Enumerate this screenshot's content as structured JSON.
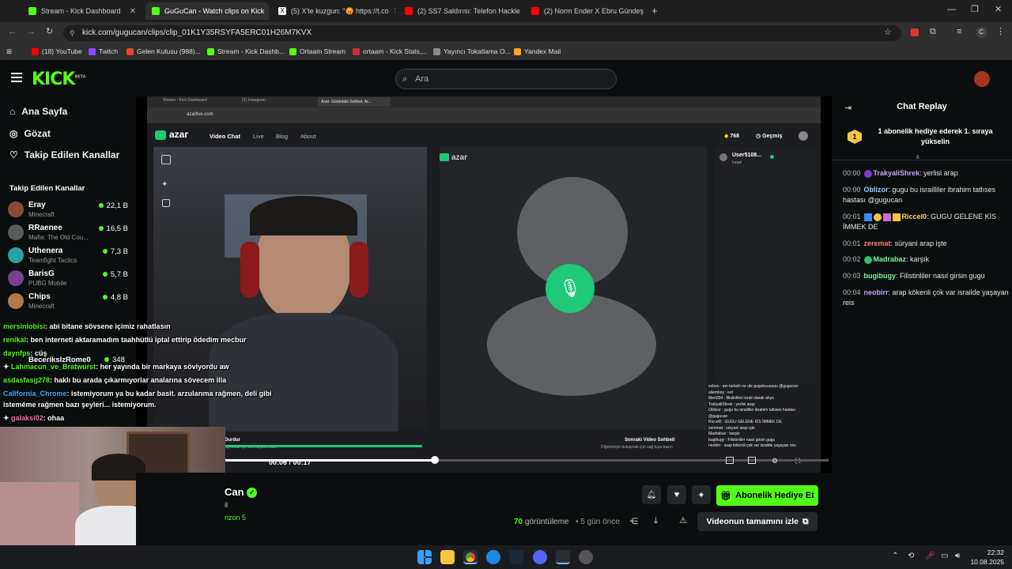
{
  "browser": {
    "tabs": [
      {
        "label": "Stream - Kick Dashboard",
        "color": "#53fc18"
      },
      {
        "label": "GuGuCan - Watch clips on Kick",
        "color": "#53fc18"
      },
      {
        "label": "(5) X'te kuzgun: \"😡 https://t.co",
        "color": "#ffffff"
      },
      {
        "label": "(2) SS7 Saldırısı: Telefon Hackle",
        "color": "#ff0000"
      },
      {
        "label": "(2) Norm Ender X Ebru Gündeş",
        "color": "#ff0000"
      }
    ],
    "url": "kick.com/gugucan/clips/clip_01K1Y35RSYFA5ERC01H26M7KVX",
    "bookmarks": [
      {
        "label": "(18) YouTube",
        "color": "#ff0000"
      },
      {
        "label": "Twitch",
        "color": "#9146ff"
      },
      {
        "label": "Gelen Kutusu (988)...",
        "color": "#ea4335"
      },
      {
        "label": "Stream - Kick Dashb...",
        "color": "#53fc18"
      },
      {
        "label": "Ortaam Stream",
        "color": "#53fc18"
      },
      {
        "label": "ortaam - Kick Stats,...",
        "color": "#cc3333"
      },
      {
        "label": "Yayıncı Tokatlama O...",
        "color": "#888888"
      },
      {
        "label": "Yandex Mail",
        "color": "#f5a623"
      }
    ]
  },
  "kick": {
    "logo": "KICK",
    "logo_badge": "BETA",
    "search_placeholder": "Ara",
    "nav": [
      {
        "label": "Ana Sayfa"
      },
      {
        "label": "Gözat"
      },
      {
        "label": "Takip Edilen Kanallar"
      }
    ],
    "followed_title": "Takip Edilen Kanallar",
    "channels": [
      {
        "name": "Eray",
        "game": "Minecraft",
        "viewers": "22,1 B",
        "color": "#8a4a3a"
      },
      {
        "name": "RRaenee",
        "game": "Mafia: The Old Cou...",
        "viewers": "16,5 B",
        "color": "#5a5a5a"
      },
      {
        "name": "Uthenera",
        "game": "Teamfight Tactics",
        "viewers": "7,3 B",
        "color": "#2aa1a1"
      },
      {
        "name": "BarisG",
        "game": "PUBG Mobile",
        "viewers": "5,7 B",
        "color": "#7a3f8f"
      },
      {
        "name": "Chips",
        "game": "Minecraft",
        "viewers": "4,8 B",
        "color": "#b07a4a"
      }
    ],
    "hidden_channel": {
      "name": "BecerikslzRome0",
      "viewers": "348"
    }
  },
  "player": {
    "inner_tabs": [
      "Stream - Kick Dashboard",
      "(2) Instagram",
      "Azar: Görüntülü Sohbet, Ar..."
    ],
    "inner_url": "azarlive.com",
    "azar_nav": [
      "Video Chat",
      "Live",
      "Blog",
      "About"
    ],
    "azar_logo": "azar",
    "coins": "768",
    "history": "Geçmiş",
    "remote_user": "User5108...",
    "remote_country": "Israel",
    "bottom_left": "Durdur",
    "bottom_left_sub": "Ayrılmak için esc tuşuna basın",
    "bottom_right": "Sonraki Video Sohbeti",
    "bottom_right_sub": "Diğerleriyle buluşmak için sağ tuşa basın",
    "time_current": "00:06",
    "time_total": "00:17",
    "progress": 0.35
  },
  "overlay_chat": [
    {
      "user": "mersinlobisi",
      "text": ": abi bitane sövsene içimiz rahatlasın"
    },
    {
      "user": "renikal",
      "text": ": ben interneti aktaramadım taahhütlü iptal ettirip ödedim mecbur"
    },
    {
      "user": "daynfps",
      "text": ": cüş"
    },
    {
      "user": "Lahmacun_ve_Bratwurst",
      "text": ": her yayında bir markaya söviyordu aw"
    },
    {
      "user": "asdasfasg278",
      "text": ": haklı bu arada çıkarmıyorlar analarına sövecem illa"
    },
    {
      "user": "California_Chrome",
      "text": ": istemiyorum ya bu kadar basit. arzularıma rağmen, deli gibi"
    },
    {
      "user": "",
      "text": "isteméme rağmen bazı şeyleri... istemiyorum."
    },
    {
      "user": "galaksi02",
      "text": ": ohaa"
    }
  ],
  "clip_info": {
    "title": "Can",
    "sub1": "il",
    "sub2": "rizon 5",
    "views": "70",
    "views_label": "görüntüleme",
    "age": "5 gün önce",
    "gift_label": "Abonelik Hediye Et",
    "full_video_label": "Videonun tamamını izle"
  },
  "chat": {
    "title": "Chat Replay",
    "pinned": "1 abonelik hediye ederek 1. sıraya yükselin",
    "messages": [
      {
        "time": "00:00",
        "user": "TrakyaliShrek",
        "user_color": "#c6a0ff",
        "text": ": yerlisi arap"
      },
      {
        "time": "00:00",
        "user": "Oblizor",
        "user_color": "#9ad0ff",
        "text": ": gugu bu israilliler ibrahim tatlıses hastası @gugucan"
      },
      {
        "time": "00:01",
        "user": "Riccel0",
        "user_color": "#ffd36b",
        "text": ": GUGU GELENE KİS İMMEK DE"
      },
      {
        "time": "00:01",
        "user": "zeremat",
        "user_color": "#ff7a7a",
        "text": ": süryani arap işte"
      },
      {
        "time": "00:02",
        "user": "Madrabaz",
        "user_color": "#7df5a0",
        "text": ": karşık"
      },
      {
        "time": "00:03",
        "user": "bugibugy",
        "user_color": "#7df5a0",
        "text": ": Filistinliler nasıl girsin gugu"
      },
      {
        "time": "00:04",
        "user": "neobirr",
        "user_color": "#c6a0ff",
        "text": ": arap kökenli çok var israilde yaşayan reis"
      }
    ]
  },
  "taskbar": {
    "time": "22:32",
    "date": "10.08.2025"
  }
}
